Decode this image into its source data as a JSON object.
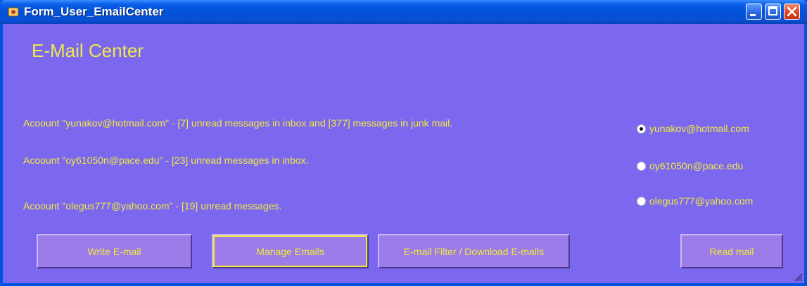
{
  "window": {
    "title": "Form_User_EmailCenter"
  },
  "heading": "E-Mail Center",
  "accounts": [
    {
      "text": "Acoount \"yunakov@hotmail.com\" - [7] unread messages in inbox and [377] messages in junk mail."
    },
    {
      "text": "Acoount \"oy61050n@pace.edu\" - [23] unread messages in inbox."
    },
    {
      "text": "Acoount \"olegus777@yahoo.com\" - [19] unread messages."
    }
  ],
  "radios": [
    {
      "label": "yunakov@hotmail.com",
      "checked": true
    },
    {
      "label": "oy61050n@pace.edu",
      "checked": false
    },
    {
      "label": "olegus777@yahoo.com",
      "checked": false
    }
  ],
  "buttons": {
    "write": "Write E-mail",
    "manage": "Manage Emails",
    "filter": "E-mail Filter / Download E-mails",
    "read": "Read mail"
  },
  "colors": {
    "client_bg": "#7b68ee",
    "text": "#f2ea3c",
    "button_bg": "#9b7ce8",
    "titlebar": "#0251d8"
  }
}
